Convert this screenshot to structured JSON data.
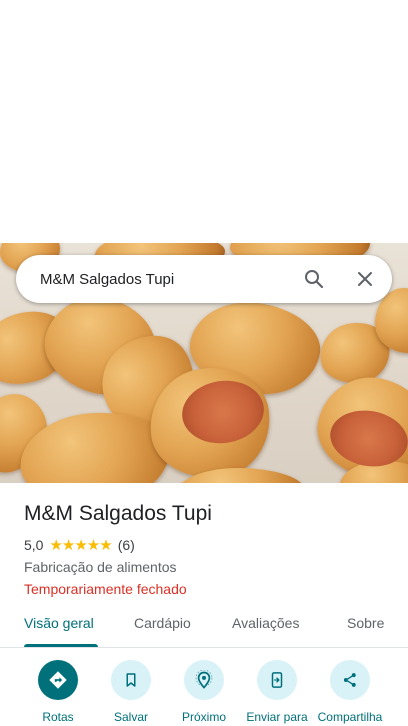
{
  "search": {
    "query": "M&M Salgados Tupi"
  },
  "place": {
    "name": "M&M Salgados Tupi",
    "rating": "5,0",
    "stars": "★★★★★",
    "review_count": "(6)",
    "category": "Fabricação de alimentos",
    "status": "Temporariamente fechado"
  },
  "tabs": [
    {
      "label": "Visão geral",
      "active": true
    },
    {
      "label": "Cardápio"
    },
    {
      "label": "Avaliações"
    },
    {
      "label": "Sobre"
    }
  ],
  "actions": [
    {
      "label": "Rotas",
      "icon": "directions-icon"
    },
    {
      "label": "Salvar",
      "icon": "bookmark-icon"
    },
    {
      "label": "Próximo",
      "icon": "nearby-icon"
    },
    {
      "label": "Enviar para",
      "icon": "send-to-phone-icon"
    },
    {
      "label": "Compartilha",
      "icon": "share-icon"
    }
  ],
  "colors": {
    "accent": "#00707a",
    "action_bg": "#d8f2f7",
    "closed_red": "#d93025",
    "star": "#fbbc04"
  }
}
